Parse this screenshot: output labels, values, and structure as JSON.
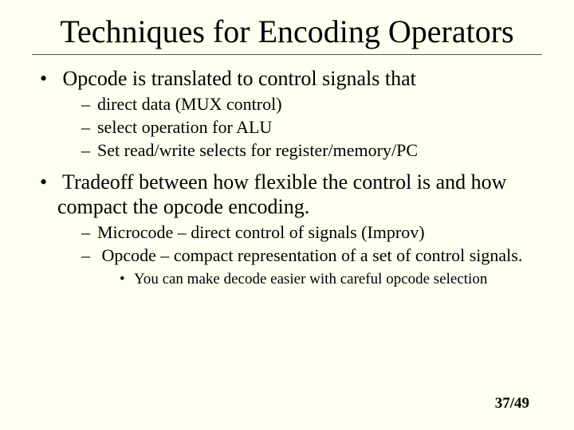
{
  "title": "Techniques for Encoding Operators",
  "bullets": {
    "b1": "Opcode is translated to control signals that",
    "b1_sub": {
      "s1": "direct data (MUX control)",
      "s2": "select operation for ALU",
      "s3": "Set read/write selects for register/memory/PC"
    },
    "b2": "Tradeoff between how flexible the control is and how compact the opcode encoding.",
    "b2_sub": {
      "s1": "Microcode – direct control of signals (Improv)",
      "s2": "Opcode – compact representation of a set of control signals.",
      "s2_sub": {
        "t1": "You can make decode easier with careful opcode selection"
      }
    }
  },
  "page": "37/49"
}
